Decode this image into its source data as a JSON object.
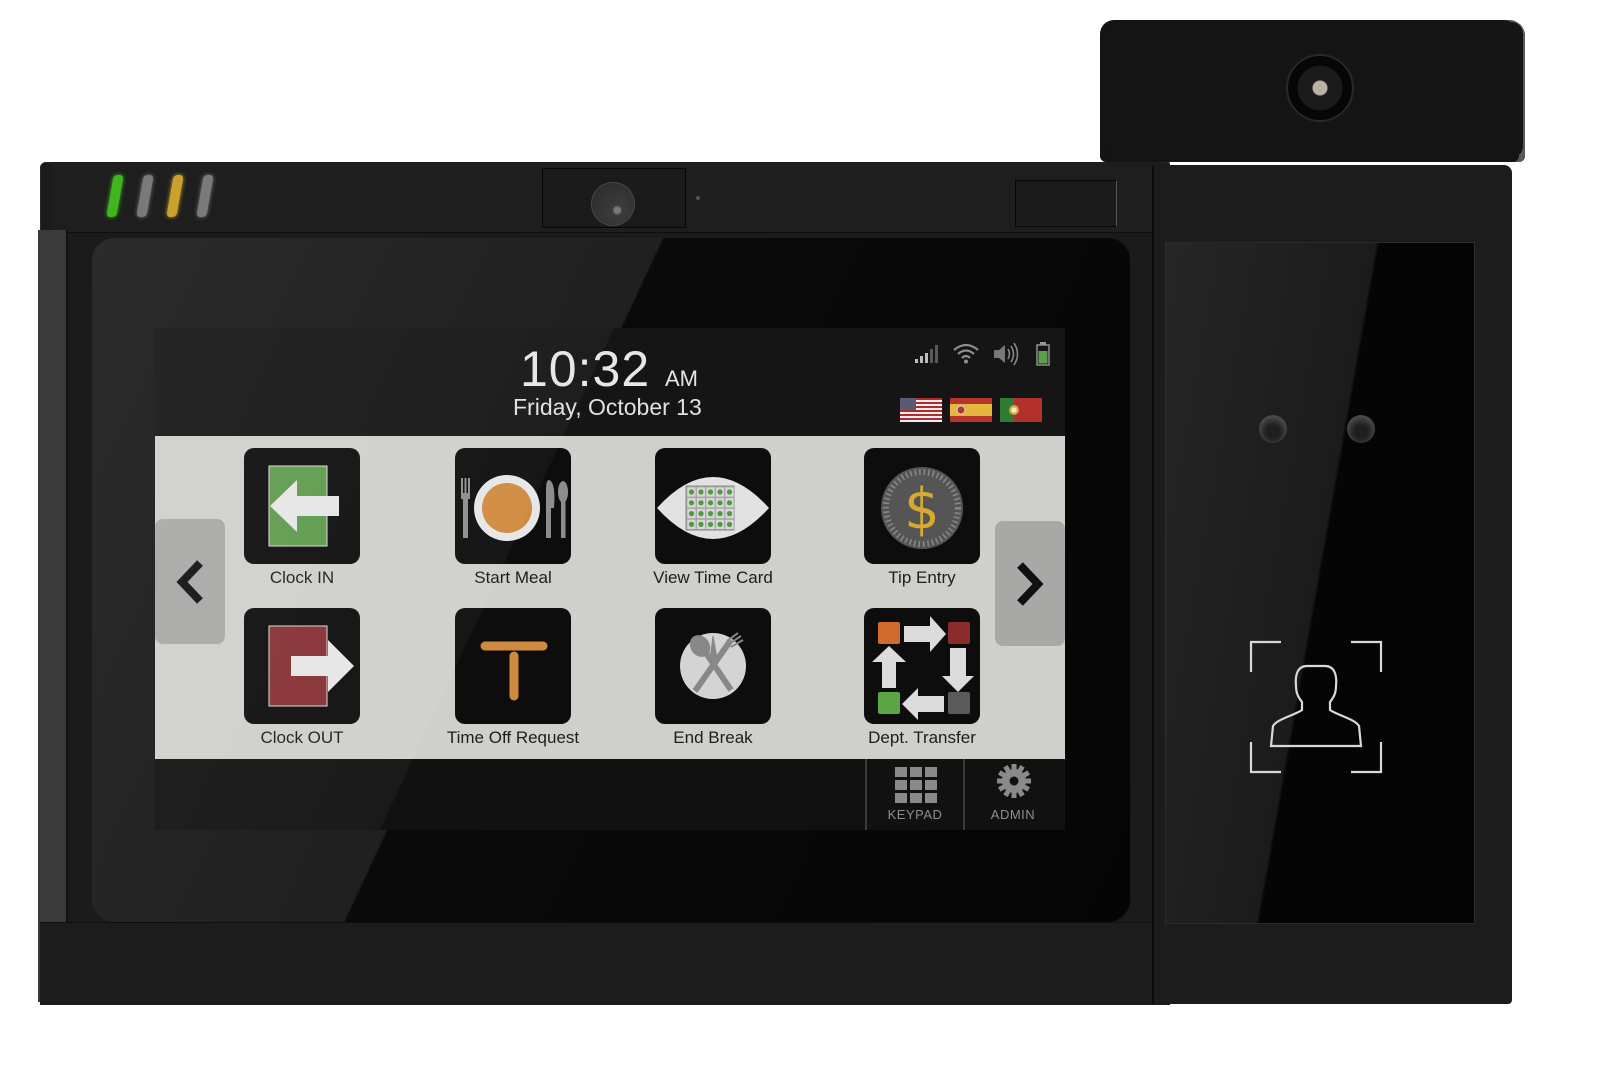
{
  "device": {
    "status_leds": [
      {
        "name": "led-1",
        "color": "#3fb51f"
      },
      {
        "name": "led-2",
        "color": "#7a7a7a"
      },
      {
        "name": "led-3",
        "color": "#c9a22c"
      },
      {
        "name": "led-4",
        "color": "#7a7a7a"
      }
    ]
  },
  "header": {
    "time": "10:32",
    "ampm": "AM",
    "date": "Friday, October 13",
    "status_icons": [
      "signal-icon",
      "wifi-icon",
      "volume-icon",
      "battery-icon"
    ],
    "languages": [
      {
        "code": "en-US",
        "label": "English (US flag)"
      },
      {
        "code": "es",
        "label": "Spanish (Spain flag)"
      },
      {
        "code": "pt",
        "label": "Portuguese (Portugal flag)"
      }
    ]
  },
  "tiles": [
    {
      "label": "Clock IN",
      "icon": "clock-in-icon"
    },
    {
      "label": "Start Meal",
      "icon": "meal-icon"
    },
    {
      "label": "View Time Card",
      "icon": "time-card-icon"
    },
    {
      "label": "Tip Entry",
      "icon": "tip-coin-icon"
    },
    {
      "label": "Clock OUT",
      "icon": "clock-out-icon"
    },
    {
      "label": "Time Off Request",
      "icon": "time-off-icon"
    },
    {
      "label": "End Break",
      "icon": "end-break-icon"
    },
    {
      "label": "Dept. Transfer",
      "icon": "dept-transfer-icon"
    }
  ],
  "navigation": {
    "prev": "chevron-left-icon",
    "next": "chevron-right-icon"
  },
  "bottom_bar": {
    "keypad_label": "KEYPAD",
    "admin_label": "ADMIN"
  },
  "colors": {
    "clock_in_green": "#5e9a4c",
    "clock_out_red": "#863033",
    "meal_orange": "#cf8a3f",
    "coin_gold": "#d7a92f",
    "tile_area_bg": "#cfcfcb"
  }
}
